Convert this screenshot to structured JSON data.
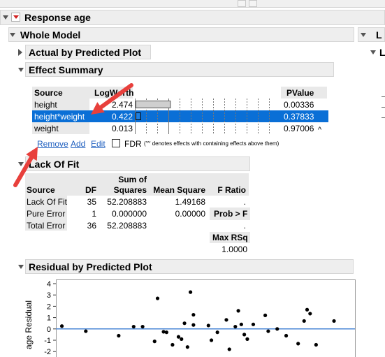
{
  "response_title": "Response age",
  "whole_model_title": "Whole Model",
  "right_panel_letter_1": "L",
  "right_panel_letter_2": "L",
  "actual_by_predicted_title": "Actual by Predicted Plot",
  "effect_summary": {
    "title": "Effect Summary",
    "headers": {
      "source": "Source",
      "logworth": "LogWorth",
      "pvalue": "PValue"
    },
    "rows": [
      {
        "source": "height",
        "logworth": "2.474",
        "pvalue": "0.00336",
        "flag": "",
        "bar_fraction": 0.95
      },
      {
        "source": "height*weight",
        "logworth": "0.422",
        "pvalue": "0.37833",
        "flag": "",
        "bar_fraction": 0.13
      },
      {
        "source": "weight",
        "logworth": "0.013",
        "pvalue": "0.97006",
        "flag": "^",
        "bar_fraction": 0.0
      }
    ],
    "remove_label": "Remove",
    "add_label": "Add",
    "edit_label": "Edit",
    "fdr_label": "FDR",
    "footnote": "('^' denotes effects with containing effects above them)"
  },
  "lack_of_fit": {
    "title": "Lack Of Fit",
    "headers": {
      "source": "Source",
      "df": "DF",
      "ss_top": "Sum of",
      "ss_bottom": "Squares",
      "ms": "Mean Square",
      "f": "F Ratio"
    },
    "rows": [
      {
        "source": "Lack Of Fit",
        "df": "35",
        "ss": "52.208883",
        "ms": "1.49168",
        "f": "."
      },
      {
        "source": "Pure Error",
        "df": "1",
        "ss": "0.000000",
        "ms": "0.00000",
        "f": "Prob > F"
      },
      {
        "source": "Total Error",
        "df": "36",
        "ss": "52.208883",
        "ms": "",
        "f": "."
      }
    ],
    "max_rsq_label": "Max RSq",
    "max_rsq_value": "1.0000"
  },
  "residual_plot": {
    "title": "Residual by Predicted Plot",
    "ylabel": "age Residual"
  },
  "chart_data": {
    "type": "scatter",
    "title": "Residual by Predicted Plot",
    "ylabel": "age Residual",
    "ylim": [
      -2.2,
      4.3
    ],
    "yticks": [
      4,
      3,
      2,
      1,
      0,
      -1,
      -2
    ],
    "xlim": [
      0,
      1
    ],
    "reference_line_y": 0,
    "points": [
      [
        0.02,
        0.25
      ],
      [
        0.1,
        -0.2
      ],
      [
        0.21,
        -0.6
      ],
      [
        0.26,
        0.2
      ],
      [
        0.29,
        0.2
      ],
      [
        0.34,
        2.7
      ],
      [
        0.33,
        -1.1
      ],
      [
        0.36,
        -0.25
      ],
      [
        0.37,
        -0.3
      ],
      [
        0.39,
        -1.4
      ],
      [
        0.41,
        -0.7
      ],
      [
        0.42,
        -0.9
      ],
      [
        0.43,
        0.5
      ],
      [
        0.44,
        -1.6
      ],
      [
        0.45,
        3.25
      ],
      [
        0.46,
        1.25
      ],
      [
        0.46,
        0.35
      ],
      [
        0.51,
        0.3
      ],
      [
        0.52,
        -1.0
      ],
      [
        0.54,
        -0.3
      ],
      [
        0.57,
        0.8
      ],
      [
        0.58,
        -1.8
      ],
      [
        0.6,
        0.2
      ],
      [
        0.61,
        1.6
      ],
      [
        0.62,
        0.4
      ],
      [
        0.63,
        -0.5
      ],
      [
        0.64,
        -0.9
      ],
      [
        0.66,
        0.4
      ],
      [
        0.7,
        1.2
      ],
      [
        0.71,
        -0.2
      ],
      [
        0.74,
        0.0
      ],
      [
        0.77,
        -0.6
      ],
      [
        0.81,
        -1.3
      ],
      [
        0.83,
        0.7
      ],
      [
        0.84,
        1.7
      ],
      [
        0.85,
        1.35
      ],
      [
        0.87,
        -1.4
      ],
      [
        0.93,
        0.7
      ]
    ],
    "line_color": "#4a86d6",
    "point_color": "#000000"
  },
  "annotation_arrow_color": "#e8403c"
}
